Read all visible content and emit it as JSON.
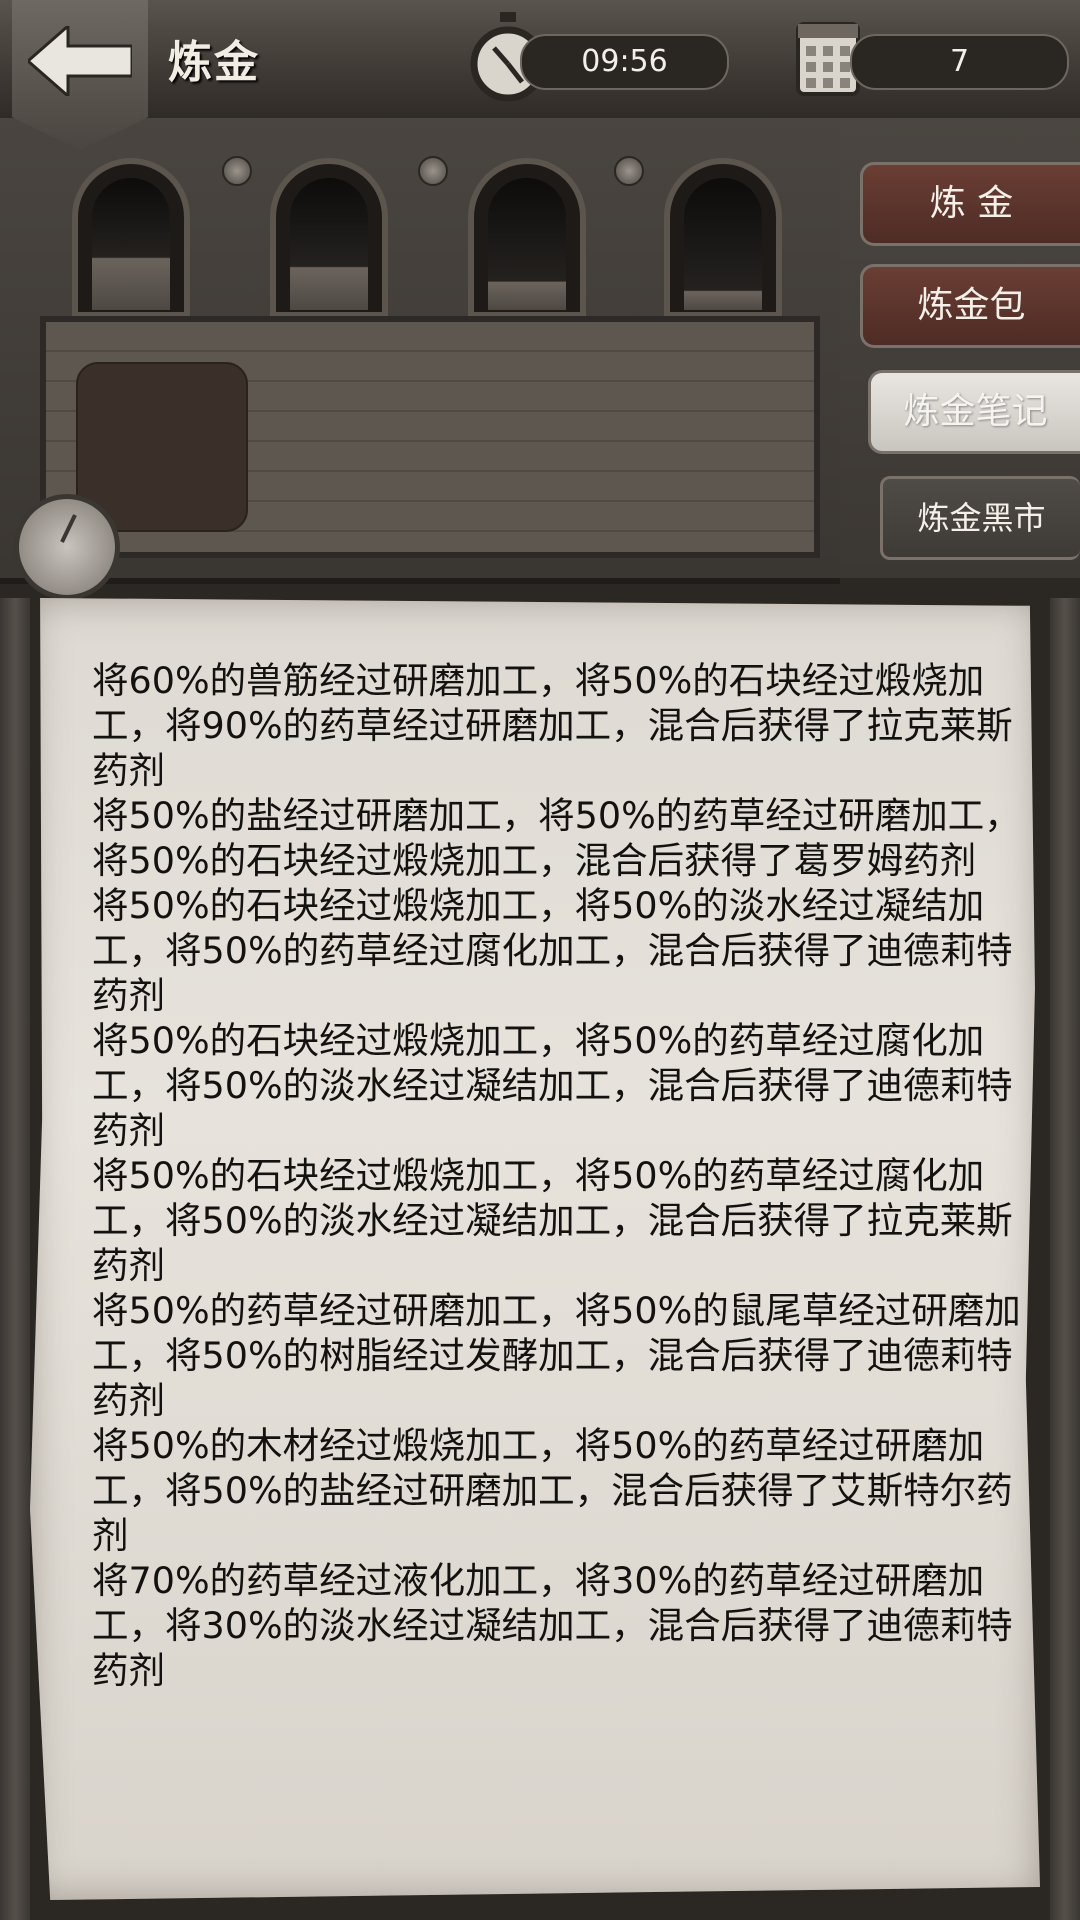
{
  "header": {
    "title": "炼金",
    "time": "09:56",
    "day": "7"
  },
  "tabs": [
    {
      "label": "炼  金",
      "state": "normal"
    },
    {
      "label": "炼金包",
      "state": "normal"
    },
    {
      "label": "炼金笔记",
      "state": "selected"
    },
    {
      "label": "炼金黑市",
      "state": "normal"
    }
  ],
  "flask_levels": [
    0.4,
    0.33,
    0.22,
    0.15
  ],
  "notes": [
    "将60%的兽筋经过研磨加工，将50%的石块经过煅烧加工，将90%的药草经过研磨加工，混合后获得了拉克莱斯药剂",
    "将50%的盐经过研磨加工，将50%的药草经过研磨加工，将50%的石块经过煅烧加工，混合后获得了葛罗姆药剂",
    "将50%的石块经过煅烧加工，将50%的淡水经过凝结加工，将50%的药草经过腐化加工，混合后获得了迪德莉特药剂",
    "将50%的石块经过煅烧加工，将50%的药草经过腐化加工，将50%的淡水经过凝结加工，混合后获得了迪德莉特药剂",
    "将50%的石块经过煅烧加工，将50%的药草经过腐化加工，将50%的淡水经过凝结加工，混合后获得了拉克莱斯药剂",
    "将50%的药草经过研磨加工，将50%的鼠尾草经过研磨加工，将50%的树脂经过发酵加工，混合后获得了迪德莉特药剂",
    "将50%的木材经过煅烧加工，将50%的药草经过研磨加工，将50%的盐经过研磨加工，混合后获得了艾斯特尔药剂",
    "将70%的药草经过液化加工，将30%的药草经过研磨加工，将30%的淡水经过凝结加工，混合后获得了迪德莉特药剂"
  ]
}
